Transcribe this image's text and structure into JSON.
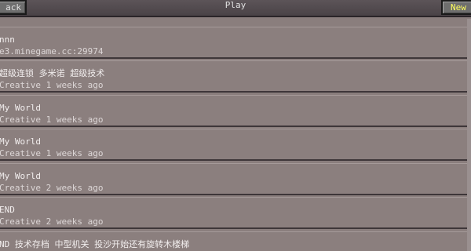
{
  "header": {
    "back_label": "ack",
    "title": "Play",
    "new_label": "New"
  },
  "worlds": [
    {
      "name": "nnn",
      "detail": "e3.minegame.cc:29974"
    },
    {
      "name": "超级连锁 多米诺 超级技术",
      "detail": "Creative  1 weeks ago"
    },
    {
      "name": "My World",
      "detail": "Creative  1 weeks ago"
    },
    {
      "name": "My World",
      "detail": "Creative  1 weeks ago"
    },
    {
      "name": "My World",
      "detail": "Creative  2 weeks ago"
    },
    {
      "name": "END",
      "detail": "Creative  2 weeks ago"
    },
    {
      "name": "ND 技术存档 中型机关 投沙开始还有旋转木楼梯",
      "detail": ""
    }
  ]
}
